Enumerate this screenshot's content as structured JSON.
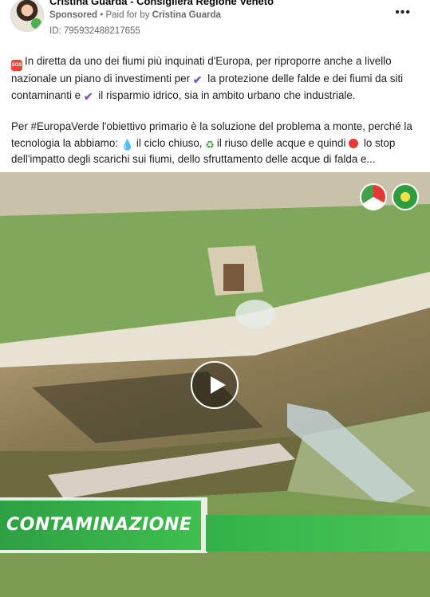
{
  "header": {
    "page_name": "Cristina Guarda - Consigliera Regione Veneto",
    "sponsored": "Sponsored",
    "separator": " • Paid for by ",
    "payer": "Cristina Guarda",
    "ad_id": "ID: 795932488217655",
    "more": "•••"
  },
  "post": {
    "p1": {
      "a": "In diretta da uno dei fiumi più inquinati d'Europa, per riproporre anche a livello nazionale un piano di investimenti per ",
      "b": " la protezione delle falde e dei fiumi da siti contaminanti e ",
      "c": " il risparmio idrico, sia in ambito urbano che industriale."
    },
    "p2": {
      "a": "Per #EuropaVerde l'obiettivo primario è la soluzione del problema a monte, perché la tecnologia la abbiamo: ",
      "b": "il ciclo chiuso, ",
      "c": "il riuso delle acque e quindi ",
      "d": " lo stop dell'impatto degli scarichi sui fiumi, dello sfruttamento delle acque di falda e..."
    },
    "emoji": {
      "sos": "SOS",
      "check": "✔",
      "drop": "💧",
      "recycle": "♻"
    }
  },
  "video": {
    "banner": "CONTAMINAZIONE",
    "icons": [
      "play-icon"
    ]
  }
}
